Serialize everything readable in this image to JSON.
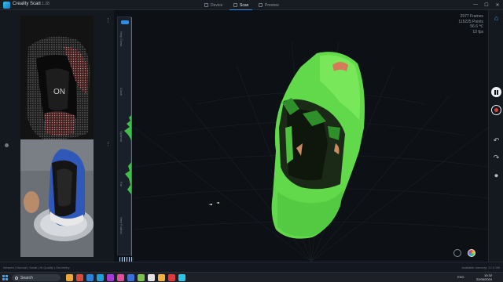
{
  "app": {
    "title": "Creality Scan",
    "version": "3.1.28"
  },
  "tabs": [
    {
      "label": "Device"
    },
    {
      "label": "Scan"
    },
    {
      "label": "Preview"
    }
  ],
  "window": {
    "minimize": "—",
    "maximize": "☐",
    "close": "✕"
  },
  "depth_strip": {
    "labels": [
      "Very Close",
      "Close",
      "Optimal",
      "Far",
      "Very Further"
    ]
  },
  "stats": {
    "frames": "2977 Frames",
    "points": "115225 Points",
    "temperature": "56.6 ℃",
    "fps": "10 fps"
  },
  "status": {
    "left": "Infrared | Normal | Small | Hi Quality | Geometry",
    "right": "Available memory: 17.0 GB"
  },
  "taskbar": {
    "search_placeholder": "Search",
    "language": "ENG",
    "time": "10:32",
    "date": "22/06/2024"
  },
  "colors": {
    "accent": "#2d8fe6",
    "scan_green": "#5fe04a",
    "record": "#e53935"
  },
  "icons": {
    "home": "home-icon",
    "pause": "pause-icon",
    "record": "record-icon",
    "undo": "undo-icon",
    "redo": "redo-icon",
    "joystick": "joystick-icon"
  }
}
